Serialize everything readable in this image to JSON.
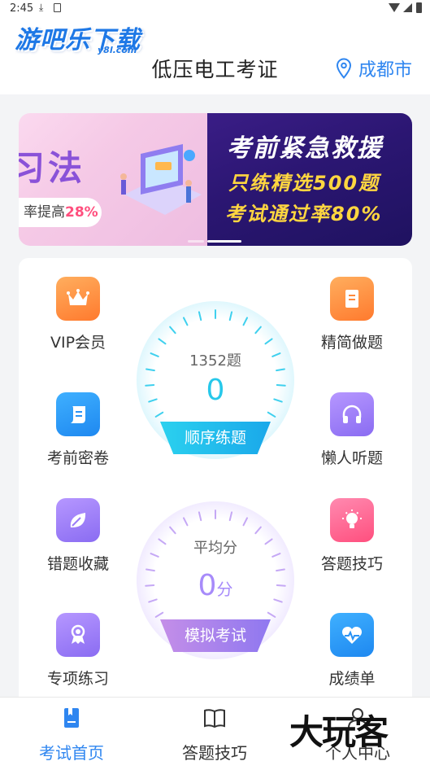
{
  "status": {
    "time": "2:45"
  },
  "brand": {
    "logo_text": "游吧乐下载",
    "logo_sub": "y8l.com"
  },
  "header": {
    "title": "低压电工考证",
    "city": "成都市"
  },
  "banner": {
    "left_text": "习法",
    "left_pill_prefix": "率提高",
    "left_pill_value": "28%",
    "line1": "考前紧急救援",
    "line2": "只练精选500题",
    "line3": "考试通过率80%"
  },
  "features": {
    "vip": "VIP会员",
    "simplified": "精简做题",
    "secret": "考前密卷",
    "listen": "懒人听题",
    "mistakes": "错题收藏",
    "tips": "答题技巧",
    "special": "专项练习",
    "scores": "成绩单"
  },
  "gauge_practice": {
    "caption": "1352题",
    "value": "0",
    "button": "顺序练题"
  },
  "gauge_exam": {
    "caption": "平均分",
    "value": "0",
    "unit": "分",
    "button": "模拟考试"
  },
  "nav": {
    "home": "考试首页",
    "tips": "答题技巧",
    "profile": "个人中心"
  },
  "watermark": "大玩客",
  "colors": {
    "accent": "#2f86f0",
    "cyan": "#27c8ea",
    "purple": "#a78bfa",
    "orange": "#ff8a3c"
  }
}
